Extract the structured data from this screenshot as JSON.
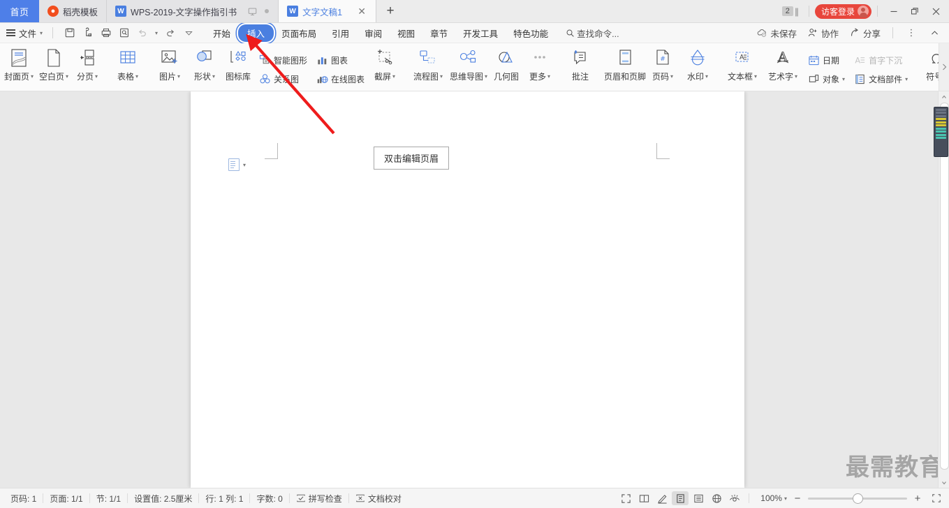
{
  "window": {
    "home_tab": "首页",
    "doc_tabs": [
      {
        "label": "稻壳模板",
        "icon": "daoke-icon",
        "active": false
      },
      {
        "label": "WPS-2019-文字操作指引书",
        "icon": "wps-writer-icon",
        "active": false
      },
      {
        "label": "文字文稿1",
        "icon": "wps-writer-icon",
        "active": true
      }
    ],
    "new_tab_label": "+",
    "tab_count_badge": "2",
    "login_label": "访客登录",
    "minimize": "—",
    "restore": "❐",
    "close": "✕"
  },
  "menubar": {
    "file_label": "文件",
    "quick_access": [
      "save-icon",
      "share-save-icon",
      "print-icon",
      "print-preview-icon",
      "undo-icon",
      "redo-icon",
      "customize-icon"
    ],
    "tabs": [
      {
        "label": "开始",
        "selected": false
      },
      {
        "label": "插入",
        "selected": true
      },
      {
        "label": "页面布局",
        "selected": false
      },
      {
        "label": "引用",
        "selected": false
      },
      {
        "label": "审阅",
        "selected": false
      },
      {
        "label": "视图",
        "selected": false
      },
      {
        "label": "章节",
        "selected": false
      },
      {
        "label": "开发工具",
        "selected": false
      },
      {
        "label": "特色功能",
        "selected": false
      }
    ],
    "find_command": "查找命令...",
    "right_items": [
      {
        "label": "未保存",
        "icon": "cloud-unsaved-icon"
      },
      {
        "label": "协作",
        "icon": "collaborate-icon"
      },
      {
        "label": "分享",
        "icon": "share-icon"
      }
    ],
    "more_icon": "more-vertical-icon",
    "collapse_icon": "chevron-up-icon"
  },
  "ribbon": {
    "groups": [
      {
        "type": "large",
        "items": [
          {
            "label": "封面页",
            "icon": "cover-page-icon",
            "caret": true
          },
          {
            "label": "空白页",
            "icon": "blank-page-icon",
            "caret": true
          },
          {
            "label": "分页",
            "icon": "page-break-icon",
            "caret": true
          }
        ]
      },
      {
        "type": "large",
        "items": [
          {
            "label": "表格",
            "icon": "table-icon",
            "caret": true
          }
        ]
      },
      {
        "type": "large",
        "items": [
          {
            "label": "图片",
            "icon": "picture-icon",
            "caret": true
          },
          {
            "label": "形状",
            "icon": "shape-icon",
            "caret": true
          },
          {
            "label": "图标库",
            "icon": "icon-library-icon",
            "caret": false
          }
        ]
      },
      {
        "type": "stacked",
        "columns": [
          {
            "rows": [
              {
                "label": "智能图形",
                "icon": "smart-art-icon",
                "caret": false,
                "dim": false
              },
              {
                "label": "关系图",
                "icon": "relation-chart-icon",
                "caret": false,
                "dim": false
              }
            ]
          },
          {
            "rows": [
              {
                "label": "图表",
                "icon": "chart-icon",
                "caret": false,
                "dim": false
              },
              {
                "label": "在线图表",
                "icon": "online-chart-icon",
                "caret": false,
                "dim": false
              }
            ]
          }
        ]
      },
      {
        "type": "large",
        "items": [
          {
            "label": "截屏",
            "icon": "screenshot-icon",
            "caret": true
          }
        ]
      },
      {
        "type": "large",
        "items": [
          {
            "label": "流程图",
            "icon": "flowchart-icon",
            "caret": true
          },
          {
            "label": "思维导图",
            "icon": "mindmap-icon",
            "caret": true
          },
          {
            "label": "几何图",
            "icon": "geometry-icon",
            "caret": false
          },
          {
            "label": "更多",
            "icon": "more-dots-icon",
            "caret": true
          }
        ]
      },
      {
        "type": "large",
        "items": [
          {
            "label": "批注",
            "icon": "comment-icon",
            "caret": false
          }
        ]
      },
      {
        "type": "large",
        "items": [
          {
            "label": "页眉和页脚",
            "icon": "header-footer-icon",
            "caret": false
          },
          {
            "label": "页码",
            "icon": "page-number-icon",
            "caret": true
          },
          {
            "label": "水印",
            "icon": "watermark-icon",
            "caret": true
          }
        ]
      },
      {
        "type": "large",
        "items": [
          {
            "label": "文本框",
            "icon": "text-box-icon",
            "caret": true
          },
          {
            "label": "艺术字",
            "icon": "word-art-icon",
            "caret": true
          }
        ]
      },
      {
        "type": "stacked",
        "columns": [
          {
            "rows": [
              {
                "label": "日期",
                "icon": "date-icon",
                "caret": false,
                "dim": false
              },
              {
                "label": "对象",
                "icon": "object-icon",
                "caret": true,
                "dim": false
              }
            ]
          },
          {
            "rows": [
              {
                "label": "首字下沉",
                "icon": "drop-cap-icon",
                "caret": false,
                "dim": true
              },
              {
                "label": "文档部件",
                "icon": "doc-parts-icon",
                "caret": true,
                "dim": false
              }
            ]
          }
        ]
      },
      {
        "type": "large",
        "items": [
          {
            "label": "符号",
            "icon": "symbol-icon",
            "caret": true
          }
        ]
      }
    ],
    "overflow_icon": "chevron-right-icon"
  },
  "document": {
    "header_tooltip": "双击编辑页眉",
    "page_icon": "page-setup-icon",
    "watermark": "最需教育"
  },
  "statusbar": {
    "left_items": [
      "页码: 1",
      "页面: 1/1",
      "节: 1/1",
      "设置值: 2.5厘米",
      "行: 1  列: 1",
      "字数: 0"
    ],
    "spell_check": "拼写检查",
    "doc_proof": "文档校对",
    "view_buttons": [
      {
        "name": "fullscreen-view-icon",
        "active": false
      },
      {
        "name": "two-page-view-icon",
        "active": false
      },
      {
        "name": "edit-pen-icon",
        "active": false
      },
      {
        "name": "page-layout-view-icon",
        "active": true
      },
      {
        "name": "outline-view-icon",
        "active": false
      },
      {
        "name": "web-view-icon",
        "active": false
      },
      {
        "name": "eye-protection-icon",
        "active": false
      }
    ],
    "zoom_level": "100%",
    "zoom_out": "−",
    "zoom_in": "+",
    "fit_icon": "fit-page-icon"
  },
  "annotation": {
    "arrow_color": "#ee1c1c",
    "points_to": "插入"
  }
}
